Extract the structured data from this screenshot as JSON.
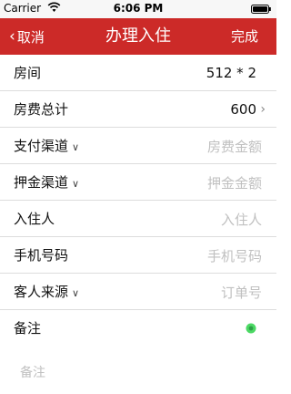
{
  "status_bar": {
    "carrier": "Carrier",
    "time": "6:06 PM"
  },
  "nav": {
    "back_label": "取消",
    "title": "办理入住",
    "done_label": "完成"
  },
  "form": {
    "room": {
      "label": "房间",
      "value": "512 * 2"
    },
    "total_fee": {
      "label": "房费总计",
      "value": "600"
    },
    "payment_channel": {
      "label": "支付渠道",
      "placeholder": "房费金额"
    },
    "deposit_channel": {
      "label": "押金渠道",
      "placeholder": "押金金额"
    },
    "guest": {
      "label": "入住人",
      "placeholder": "入住人"
    },
    "phone": {
      "label": "手机号码",
      "placeholder": "手机号码"
    },
    "guest_source": {
      "label": "客人来源",
      "placeholder": "订单号"
    },
    "remark": {
      "label": "备注",
      "placeholder": "备注"
    }
  },
  "colors": {
    "nav_background": "#cc2a28",
    "remark_indicator": "#4cd964"
  },
  "icons": [
    "wifi-icon",
    "battery-icon",
    "back-chevron-icon",
    "chevron-right-icon",
    "dropdown-caret-icon",
    "remark-status-icon"
  ]
}
